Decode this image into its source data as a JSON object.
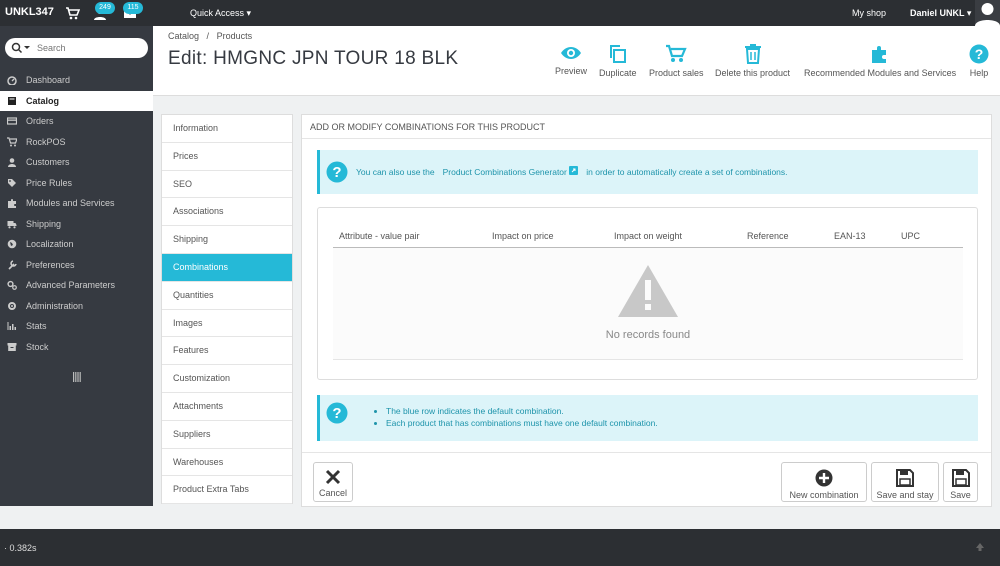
{
  "topbar": {
    "brand": "UNKL347",
    "orders_badge": "249",
    "messages_badge": "115",
    "quick_access": "Quick Access",
    "my_shop": "My shop",
    "user": "Daniel UNKL"
  },
  "search": {
    "placeholder": "Search"
  },
  "sidebar": {
    "items": [
      {
        "label": "Dashboard",
        "icon": "dashboard-icon"
      },
      {
        "label": "Catalog",
        "icon": "book-icon"
      },
      {
        "label": "Orders",
        "icon": "credit-card-icon"
      },
      {
        "label": "RockPOS",
        "icon": "cart-icon"
      },
      {
        "label": "Customers",
        "icon": "user-icon"
      },
      {
        "label": "Price Rules",
        "icon": "tag-icon"
      },
      {
        "label": "Modules and Services",
        "icon": "puzzle-icon"
      },
      {
        "label": "Shipping",
        "icon": "truck-icon"
      },
      {
        "label": "Localization",
        "icon": "globe-icon"
      },
      {
        "label": "Preferences",
        "icon": "wrench-icon"
      },
      {
        "label": "Advanced Parameters",
        "icon": "cogs-icon"
      },
      {
        "label": "Administration",
        "icon": "cog-icon"
      },
      {
        "label": "Stats",
        "icon": "bar-chart-icon"
      },
      {
        "label": "Stock",
        "icon": "archive-icon"
      }
    ]
  },
  "header": {
    "breadcrumb": [
      "Catalog",
      "/",
      "Products"
    ],
    "title": "Edit: HMGNC JPN TOUR 18 BLK",
    "toolbar": {
      "preview": "Preview",
      "duplicate": "Duplicate",
      "product_sales": "Product sales",
      "delete": "Delete this product",
      "recommended": "Recommended Modules and Services",
      "help": "Help"
    }
  },
  "tabs": [
    "Information",
    "Prices",
    "SEO",
    "Associations",
    "Shipping",
    "Combinations",
    "Quantities",
    "Images",
    "Features",
    "Customization",
    "Attachments",
    "Suppliers",
    "Warehouses",
    "Product Extra Tabs"
  ],
  "panel": {
    "heading": "Add or modify combinations for this product",
    "alert1": {
      "before": "You can also use the",
      "link": "Product Combinations Generator",
      "after": "in order to automatically create a set of combinations."
    },
    "table": {
      "columns": [
        "Attribute - value pair",
        "Impact on price",
        "Impact on weight",
        "Reference",
        "EAN-13",
        "UPC"
      ],
      "empty": "No records found"
    },
    "alert2": [
      "The blue row indicates the default combination.",
      "Each product that has combinations must have one default combination."
    ],
    "buttons": {
      "cancel": "Cancel",
      "new_combination": "New combination",
      "save_and_stay": "Save and stay",
      "save": "Save"
    }
  },
  "footer": {
    "timing": "· 0.382s"
  },
  "colors": {
    "accent": "#25b9d7",
    "sidebar": "#363a41",
    "topbar": "#2c2f33"
  }
}
